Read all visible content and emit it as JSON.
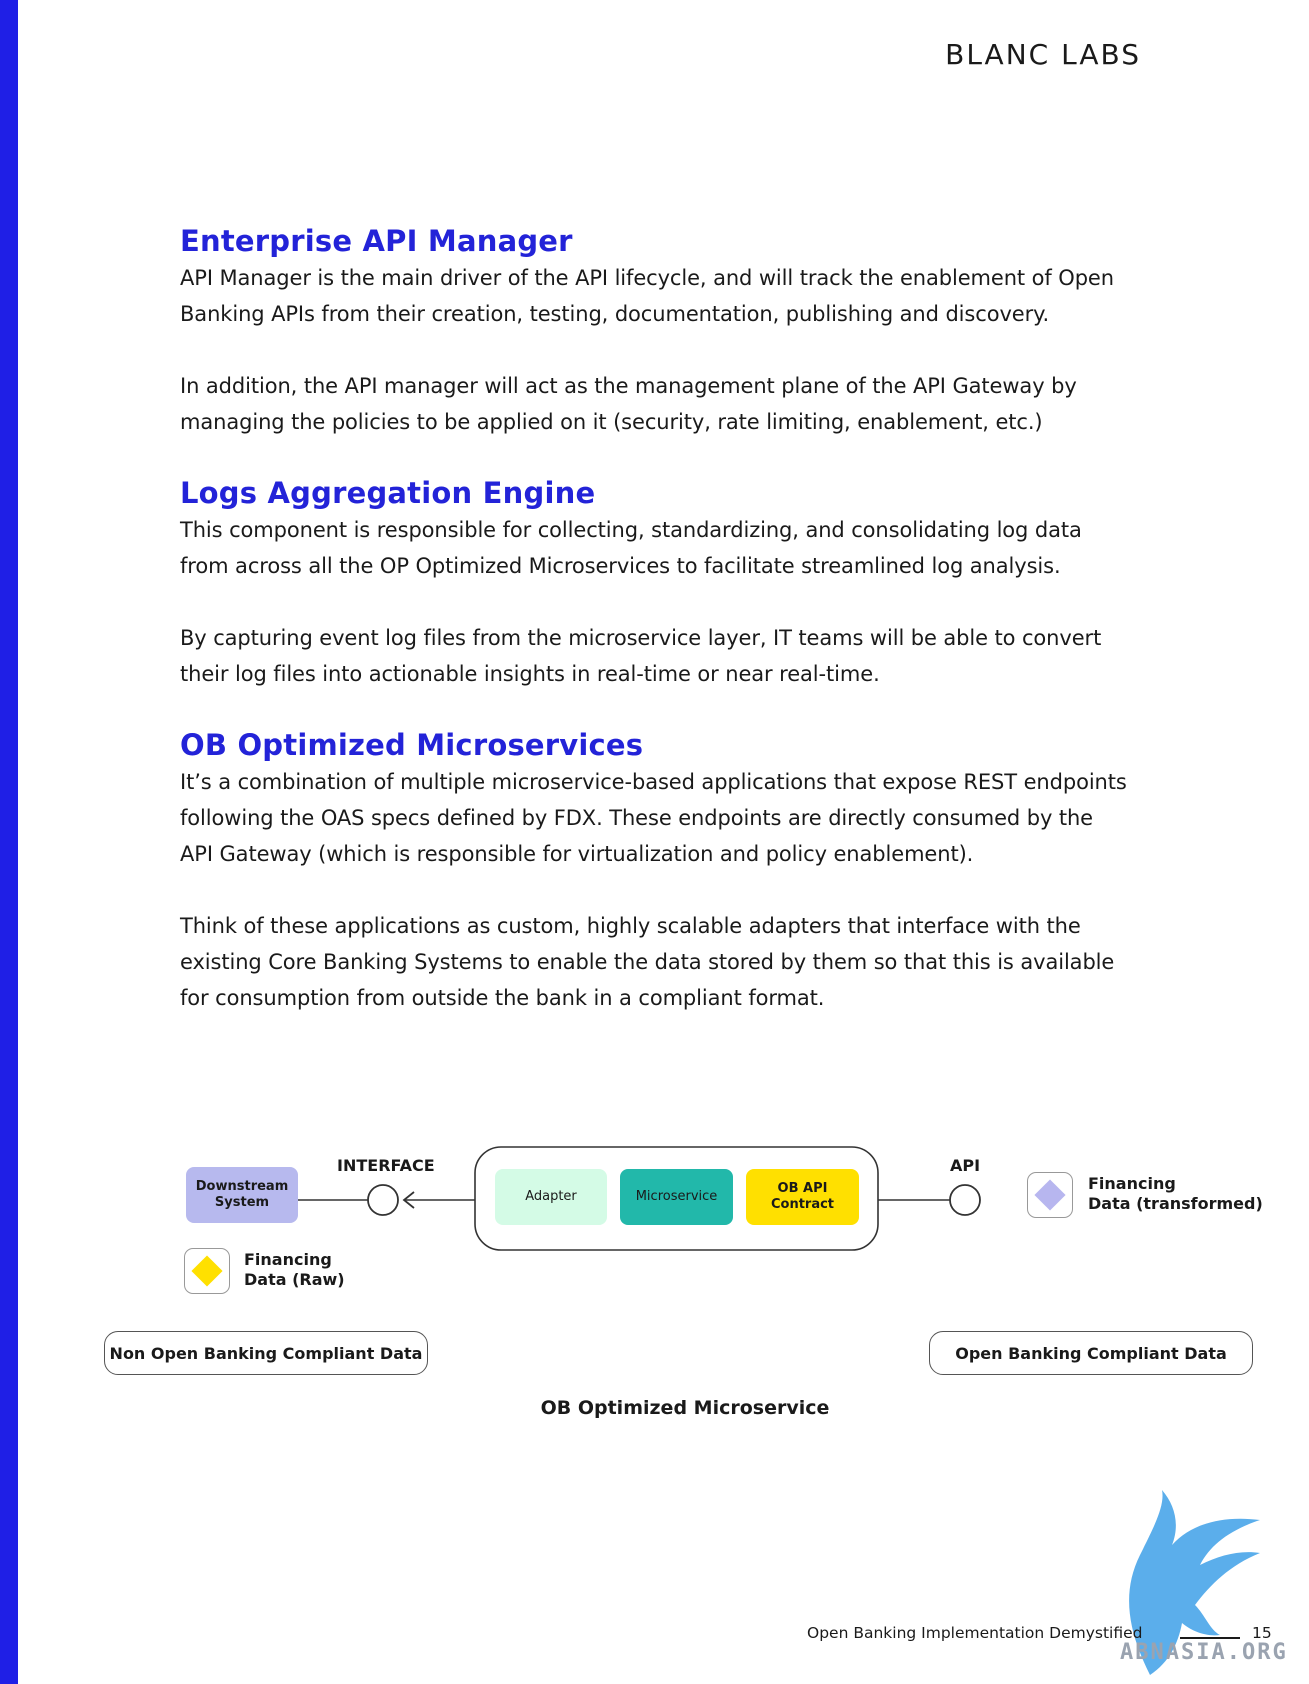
{
  "header": {
    "logo": "BLANC LABS"
  },
  "sections": [
    {
      "title": "Enterprise API Manager",
      "paragraphs": [
        [
          "API Manager is the main driver of the API lifecycle, and will track the enablement of Open",
          "Banking APIs from their creation, testing, documentation, publishing and discovery."
        ],
        [
          "In addition, the API manager will act as the management plane of the API Gateway by",
          "managing the policies to be applied on it (security, rate limiting, enablement, etc.)"
        ]
      ]
    },
    {
      "title": "Logs Aggregation Engine",
      "paragraphs": [
        [
          "This component is responsible for collecting, standardizing, and consolidating log data",
          "from across all the OP Optimized Microservices to facilitate streamlined log analysis."
        ],
        [
          "By capturing event log files from the microservice layer, IT teams will be able to convert",
          "their log files into actionable insights in real-time or near real-time."
        ]
      ]
    },
    {
      "title": "OB Optimized Microservices",
      "paragraphs": [
        [
          "It’s a combination of multiple microservice-based applications that expose REST endpoints",
          "following the OAS specs defined by FDX. These endpoints are directly consumed by the",
          "API Gateway (which is responsible for virtualization and policy enablement)."
        ],
        [
          "Think of these applications as custom, highly scalable adapters that interface with the",
          "existing Core Banking Systems to enable the data stored by them so that this is available",
          "for consumption from outside the bank in a compliant format."
        ]
      ]
    }
  ],
  "diagram": {
    "downstream_line1": "Downstream",
    "downstream_line2": "System",
    "interface_label": "INTERFACE",
    "api_label": "API",
    "adapter": "Adapter",
    "microservice": "Microservice",
    "contract_line1": "OB API",
    "contract_line2": "Contract",
    "raw_line1": "Financing",
    "raw_line2": "Data (Raw)",
    "transformed_line1": "Financing",
    "transformed_line2": "Data (transformed)",
    "non_compliant": "Non Open Banking Compliant Data",
    "compliant": "Open Banking Compliant Data",
    "caption": "OB Optimized Microservice",
    "colors": {
      "downstream": "#b7b9ee",
      "adapter": "#d4fbe6",
      "microservice": "#22b8aa",
      "contract": "#ffe000",
      "raw_diamond": "#ffe000",
      "transformed_diamond": "#b7b6ef"
    }
  },
  "footer": {
    "title": "Open Banking Implementation Demystified",
    "page": "15"
  },
  "watermark": {
    "text": "ABNASIA.ORG"
  }
}
